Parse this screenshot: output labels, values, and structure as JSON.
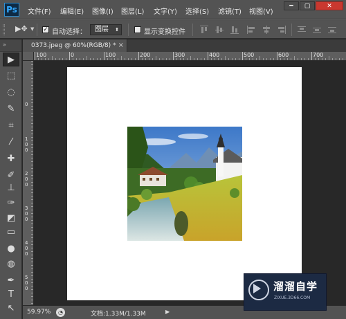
{
  "app": {
    "logo": "Ps",
    "menu": [
      "文件(F)",
      "编辑(E)",
      "图像(I)",
      "图层(L)",
      "文字(Y)",
      "选择(S)",
      "滤镜(T)",
      "视图(V)"
    ],
    "window_controls": {
      "minimize": "━",
      "maximize": "▢",
      "close": "✕"
    }
  },
  "options": {
    "tool_glyph": "▶✥",
    "auto_select_checked": true,
    "auto_select_label": "自动选择：",
    "auto_select_value": "图层",
    "show_transform_checked": false,
    "show_transform_label": "显示变换控件"
  },
  "toolbox": {
    "header": "»",
    "tools": [
      {
        "name": "move-tool-icon",
        "glyph": "▶"
      },
      {
        "name": "marquee-tool-icon",
        "glyph": "⬚"
      },
      {
        "name": "lasso-tool-icon",
        "glyph": "◌"
      },
      {
        "name": "quick-select-tool-icon",
        "glyph": "✎"
      },
      {
        "name": "crop-tool-icon",
        "glyph": "⌗"
      },
      {
        "name": "eyedropper-tool-icon",
        "glyph": "⁄"
      },
      {
        "name": "healing-brush-tool-icon",
        "glyph": "✚"
      },
      {
        "name": "brush-tool-icon",
        "glyph": "✐"
      },
      {
        "name": "clone-stamp-tool-icon",
        "glyph": "⊥"
      },
      {
        "name": "history-brush-tool-icon",
        "glyph": "✑"
      },
      {
        "name": "eraser-tool-icon",
        "glyph": "◩"
      },
      {
        "name": "gradient-tool-icon",
        "glyph": "▭"
      },
      {
        "name": "blur-tool-icon",
        "glyph": "●"
      },
      {
        "name": "dodge-tool-icon",
        "glyph": "◍"
      },
      {
        "name": "pen-tool-icon",
        "glyph": "✒"
      },
      {
        "name": "type-tool-icon",
        "glyph": "T"
      },
      {
        "name": "path-select-tool-icon",
        "glyph": "↖"
      }
    ]
  },
  "document": {
    "tab_title": "0373.jpeg @ 60%(RGB/8) *",
    "tab_close": "×"
  },
  "rulers": {
    "horizontal_labels": [
      "100",
      "0",
      "100",
      "200",
      "300",
      "400",
      "500",
      "600",
      "700"
    ],
    "vertical_labels": [
      "0",
      "1\n0\n0",
      "2\n0\n0",
      "3\n0\n0",
      "4\n0\n0",
      "5\n0\n0"
    ]
  },
  "status": {
    "zoom": "59.97%",
    "doc_info": "文档:1.33M/1.33M",
    "arrow": "▶"
  },
  "watermark": {
    "title": "溜溜自学",
    "url": "ZIXUE.3D66.COM"
  },
  "colors": {
    "chrome": "#535353",
    "workspace": "#282828",
    "ps_blue": "#31a8ff",
    "close_red": "#c9382f"
  }
}
